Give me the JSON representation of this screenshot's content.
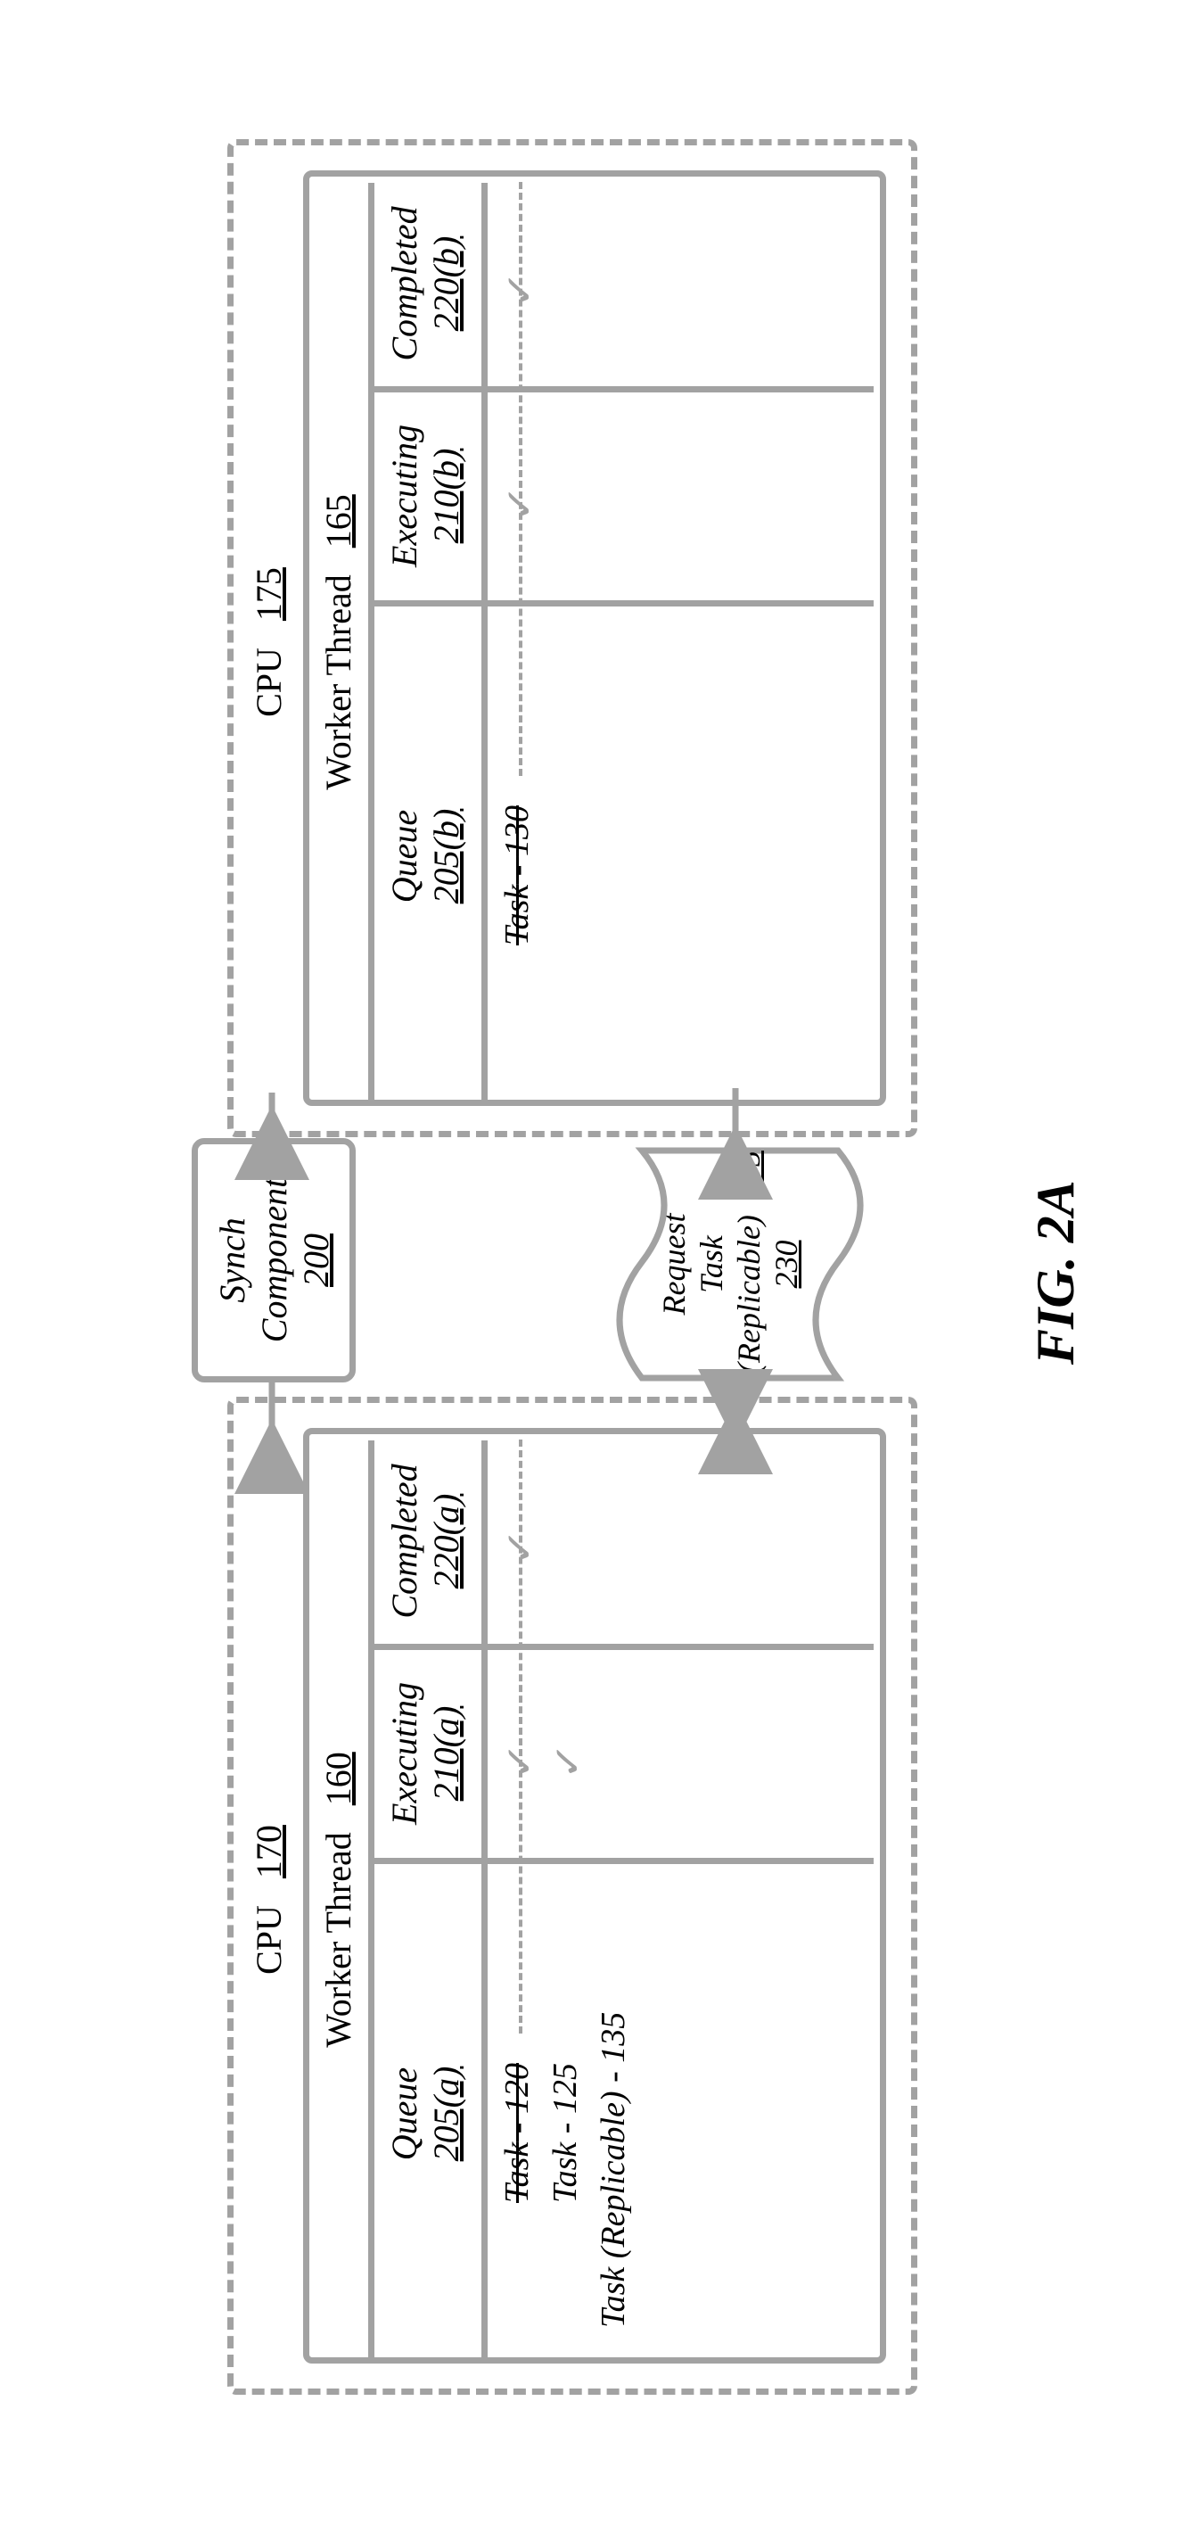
{
  "fig_label": "FIG. 2A",
  "synch": {
    "name": "Synch Component",
    "ref": "200"
  },
  "doc": {
    "name": "Request Task (Replicable)",
    "ref": "230",
    "task_ref": "135"
  },
  "cpu_a": {
    "title": "CPU",
    "ref": "170",
    "worker_title": "Worker Thread",
    "worker_ref": "160",
    "cols": {
      "queue": {
        "name": "Queue",
        "ref": "205(a)"
      },
      "exec": {
        "name": "Executing",
        "ref": "210(a)"
      },
      "comp": {
        "name": "Completed",
        "ref": "220(a)"
      }
    },
    "tasks": [
      {
        "label": "Task",
        "ref": "120",
        "strike": true,
        "exec_check": true,
        "comp_check": true
      },
      {
        "label": "Task",
        "ref": "125",
        "strike": false,
        "exec_check": true,
        "comp_check": false
      },
      {
        "label": "Task (Replicable)",
        "ref": "135",
        "strike": false,
        "exec_check": false,
        "comp_check": false
      }
    ]
  },
  "cpu_b": {
    "title": "CPU",
    "ref": "175",
    "worker_title": "Worker Thread",
    "worker_ref": "165",
    "cols": {
      "queue": {
        "name": "Queue",
        "ref": "205(b)"
      },
      "exec": {
        "name": "Executing",
        "ref": "210(b)"
      },
      "comp": {
        "name": "Completed",
        "ref": "220(b)"
      }
    },
    "tasks": [
      {
        "label": "Task",
        "ref": "130",
        "strike": true,
        "exec_check": true,
        "comp_check": true
      }
    ]
  }
}
